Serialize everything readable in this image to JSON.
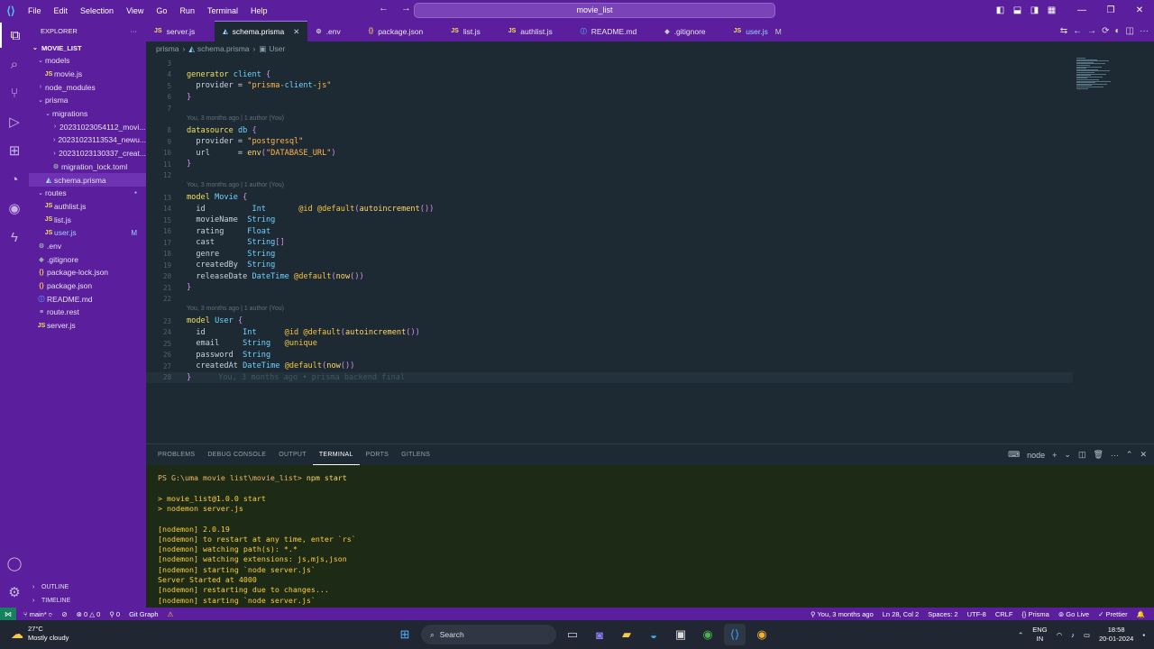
{
  "titlebar": {
    "menu": [
      "File",
      "Edit",
      "Selection",
      "View",
      "Go",
      "Run",
      "Terminal",
      "Help"
    ],
    "search": "movie_list"
  },
  "explorer": {
    "header": "EXPLORER",
    "root": "MOVIE_LIST",
    "items": [
      {
        "label": "models",
        "kind": "folder",
        "depth": 1,
        "open": true
      },
      {
        "label": "movie.js",
        "kind": "js",
        "depth": 2
      },
      {
        "label": "node_modules",
        "kind": "folder",
        "depth": 1,
        "open": false
      },
      {
        "label": "prisma",
        "kind": "folder",
        "depth": 1,
        "open": true
      },
      {
        "label": "migrations",
        "kind": "folder",
        "depth": 2,
        "open": true
      },
      {
        "label": "20231023054112_movi...",
        "kind": "folder",
        "depth": 3,
        "open": false
      },
      {
        "label": "20231023113534_newu...",
        "kind": "folder",
        "depth": 3,
        "open": false
      },
      {
        "label": "20231023130337_creat...",
        "kind": "folder",
        "depth": 3,
        "open": false
      },
      {
        "label": "migration_lock.toml",
        "kind": "gear",
        "depth": 3
      },
      {
        "label": "schema.prisma",
        "kind": "prisma",
        "depth": 2,
        "selected": true
      },
      {
        "label": "routes",
        "kind": "folder",
        "depth": 1,
        "open": true,
        "dot": true
      },
      {
        "label": "authlist.js",
        "kind": "js",
        "depth": 2
      },
      {
        "label": "list.js",
        "kind": "js",
        "depth": 2
      },
      {
        "label": "user.js",
        "kind": "js",
        "depth": 2,
        "badge": "M"
      },
      {
        "label": ".env",
        "kind": "gear",
        "depth": 1
      },
      {
        "label": ".gitignore",
        "kind": "git",
        "depth": 1
      },
      {
        "label": "package-lock.json",
        "kind": "json",
        "depth": 1
      },
      {
        "label": "package.json",
        "kind": "json",
        "depth": 1
      },
      {
        "label": "README.md",
        "kind": "md",
        "depth": 1
      },
      {
        "label": "route.rest",
        "kind": "rest",
        "depth": 1
      },
      {
        "label": "server.js",
        "kind": "js",
        "depth": 1
      }
    ],
    "outline": "OUTLINE",
    "timeline": "TIMELINE"
  },
  "tabs": [
    {
      "label": "server.js",
      "icon": "JS"
    },
    {
      "label": "schema.prisma",
      "icon": "◭",
      "active": true
    },
    {
      "label": ".env",
      "icon": "⚙"
    },
    {
      "label": "package.json",
      "icon": "{}"
    },
    {
      "label": "list.js",
      "icon": "JS"
    },
    {
      "label": "authlist.js",
      "icon": "JS"
    },
    {
      "label": "README.md",
      "icon": "ⓘ"
    },
    {
      "label": ".gitignore",
      "icon": "◆"
    },
    {
      "label": "user.js",
      "icon": "JS",
      "modified": "M"
    }
  ],
  "breadcrumbs": [
    "prisma",
    "schema.prisma",
    "User"
  ],
  "editor": {
    "lens_text": "You, 3 months ago | 1 author (You)",
    "ghost_text": "You, 3 months ago • prisma backend final",
    "lines": [
      {
        "n": "3",
        "code": ""
      },
      {
        "n": "4",
        "code": "generator client {"
      },
      {
        "n": "5",
        "code": "  provider = \"prisma-client-js\""
      },
      {
        "n": "6",
        "code": "}"
      },
      {
        "n": "7",
        "code": ""
      },
      {
        "n": "8",
        "code": "datasource db {"
      },
      {
        "n": "9",
        "code": "  provider = \"postgresql\""
      },
      {
        "n": "10",
        "code": "  url      = env(\"DATABASE_URL\")"
      },
      {
        "n": "11",
        "code": "}"
      },
      {
        "n": "12",
        "code": ""
      },
      {
        "n": "13",
        "code": "model Movie {"
      },
      {
        "n": "14",
        "code": "  id          Int       @id @default(autoincrement())"
      },
      {
        "n": "15",
        "code": "  movieName  String"
      },
      {
        "n": "16",
        "code": "  rating     Float"
      },
      {
        "n": "17",
        "code": "  cast       String[]"
      },
      {
        "n": "18",
        "code": "  genre      String"
      },
      {
        "n": "19",
        "code": "  createdBy  String"
      },
      {
        "n": "20",
        "code": "  releaseDate DateTime @default(now())"
      },
      {
        "n": "21",
        "code": "}"
      },
      {
        "n": "22",
        "code": ""
      },
      {
        "n": "23",
        "code": "model User {"
      },
      {
        "n": "24",
        "code": "  id        Int      @id @default(autoincrement())"
      },
      {
        "n": "25",
        "code": "  email     String   @unique"
      },
      {
        "n": "26",
        "code": "  password  String"
      },
      {
        "n": "27",
        "code": "  createdAt DateTime @default(now())"
      },
      {
        "n": "28",
        "code": "}"
      }
    ]
  },
  "panel": {
    "tabs": [
      "PROBLEMS",
      "DEBUG CONSOLE",
      "OUTPUT",
      "TERMINAL",
      "PORTS",
      "GITLENS"
    ],
    "active_tab": "TERMINAL",
    "terminal_name": "node",
    "lines": [
      "PS G:\\uma movie list\\movie_list> npm start",
      "",
      "> movie_list@1.0.0 start",
      "> nodemon server.js",
      "",
      "[nodemon] 2.0.19",
      "[nodemon] to restart at any time, enter `rs`",
      "[nodemon] watching path(s): *.*",
      "[nodemon] watching extensions: js,mjs,json",
      "[nodemon] starting `node server.js`",
      "Server Started at 4000",
      "[nodemon] restarting due to changes...",
      "[nodemon] starting `node server.js`"
    ]
  },
  "statusbar": {
    "branch": "main*",
    "errors": "0",
    "warnings": "0",
    "ports": "0",
    "git_graph": "Git Graph",
    "blame": "You, 3 months ago",
    "position": "Ln 28, Col 2",
    "spaces": "Spaces: 2",
    "encoding": "UTF-8",
    "eol": "CRLF",
    "language": "Prisma",
    "golive": "Go Live",
    "prettier": "Prettier"
  },
  "taskbar": {
    "temp": "27°C",
    "weather": "Mostly cloudy",
    "search": "Search",
    "lang1": "ENG",
    "lang2": "IN",
    "time": "18:58",
    "date": "20-01-2024"
  },
  "colors": {
    "accent": "#5b1f9e",
    "editor_bg": "#1e2a33",
    "terminal_bg": "#1c2a16",
    "remote": "#16825d"
  }
}
